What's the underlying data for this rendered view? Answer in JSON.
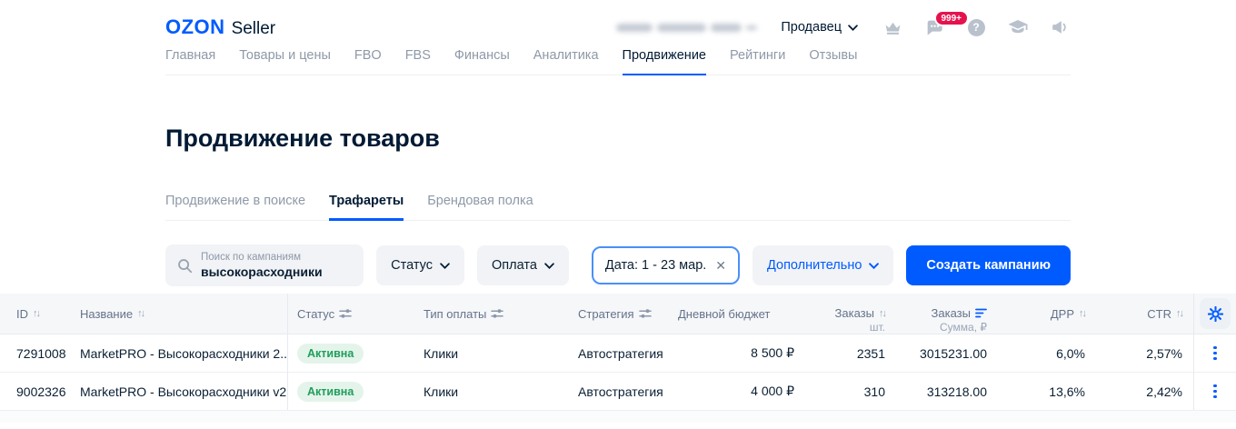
{
  "header": {
    "logo_brand": "OZON",
    "logo_suffix": "Seller",
    "seller_menu_label": "Продавец",
    "messages_badge": "999+"
  },
  "nav": {
    "items": [
      {
        "label": "Главная",
        "active": false
      },
      {
        "label": "Товары и цены",
        "active": false
      },
      {
        "label": "FBO",
        "active": false
      },
      {
        "label": "FBS",
        "active": false
      },
      {
        "label": "Финансы",
        "active": false
      },
      {
        "label": "Аналитика",
        "active": false
      },
      {
        "label": "Продвижение",
        "active": true
      },
      {
        "label": "Рейтинги",
        "active": false
      },
      {
        "label": "Отзывы",
        "active": false
      }
    ]
  },
  "page_title": "Продвижение товаров",
  "tabs": [
    {
      "label": "Продвижение в поиске",
      "active": false
    },
    {
      "label": "Трафареты",
      "active": true
    },
    {
      "label": "Брендовая полка",
      "active": false
    }
  ],
  "filters": {
    "search_placeholder": "Поиск по кампаниям",
    "search_value": "высокорасходники",
    "status_label": "Статус",
    "payment_label": "Оплата",
    "date_filter": "Дата: 1 - 23 мар.",
    "more_label": "Дополнительно",
    "create_campaign_label": "Создать кампанию"
  },
  "table": {
    "sort_active_column": "orders_sum",
    "columns": {
      "id": "ID",
      "name": "Название",
      "status": "Статус",
      "payment_type": "Тип оплаты",
      "strategy": "Стратегия",
      "daily_budget": "Дневной бюджет",
      "orders_qty": "Заказы",
      "orders_qty_sub": "шт.",
      "orders_sum": "Заказы",
      "orders_sum_sub": "Сумма, ₽",
      "drr": "ДРР",
      "ctr": "CTR"
    },
    "rows": [
      {
        "id": "7291008",
        "name": "MarketPRO - Высокорасходники 2...",
        "status": "Активна",
        "payment_type": "Клики",
        "strategy": "Автостратегия",
        "daily_budget": "8 500 ₽",
        "orders_qty": "2351",
        "orders_sum": "3015231.00",
        "drr": "6,0%",
        "ctr": "2,57%"
      },
      {
        "id": "9002326",
        "name": "MarketPRO - Высокорасходники v2",
        "status": "Активна",
        "payment_type": "Клики",
        "strategy": "Автостратегия",
        "daily_budget": "4 000 ₽",
        "orders_qty": "310",
        "orders_sum": "313218.00",
        "drr": "13,6%",
        "ctr": "2,42%"
      }
    ]
  },
  "colors": {
    "accent": "#005bff",
    "badge_red": "#e4134e",
    "status_green_text": "#1f9e5c",
    "status_green_bg": "#e4f4ea"
  }
}
